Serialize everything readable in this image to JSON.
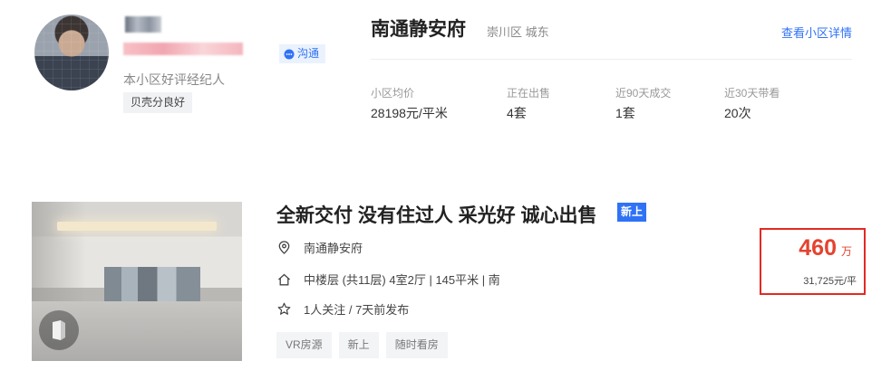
{
  "agent": {
    "title": "本小区好评经纪人",
    "badge": "贝壳分良好",
    "chat_label": "沟通"
  },
  "community": {
    "name": "南通静安府",
    "area": "崇川区 城东",
    "detail_link": "查看小区详情",
    "stats": [
      {
        "label": "小区均价",
        "value": "28198元/平米"
      },
      {
        "label": "正在出售",
        "value": "4套"
      },
      {
        "label": "近90天成交",
        "value": "1套"
      },
      {
        "label": "近30天带看",
        "value": "20次"
      }
    ]
  },
  "listing": {
    "title": "全新交付 没有住过人 采光好 诚心出售",
    "new_tag": "新上",
    "community_name": "南通静安府",
    "house_info": "中楼层 (共11层) 4室2厅 | 145平米 | 南",
    "follow_info": "1人关注 / 7天前发布",
    "tags": [
      "VR房源",
      "新上",
      "随时看房"
    ],
    "price": {
      "total": "460",
      "unit": "万",
      "per_sqm": "31,725元/平"
    }
  },
  "colors": {
    "accent_blue": "#3072f6",
    "price_red": "#e5432f",
    "highlight_border": "#e22a22"
  },
  "icons": {
    "chat": "chat-bubble-icon",
    "location": "location-pin-icon",
    "house": "house-icon",
    "star": "star-icon",
    "vr": "vr-icon"
  }
}
